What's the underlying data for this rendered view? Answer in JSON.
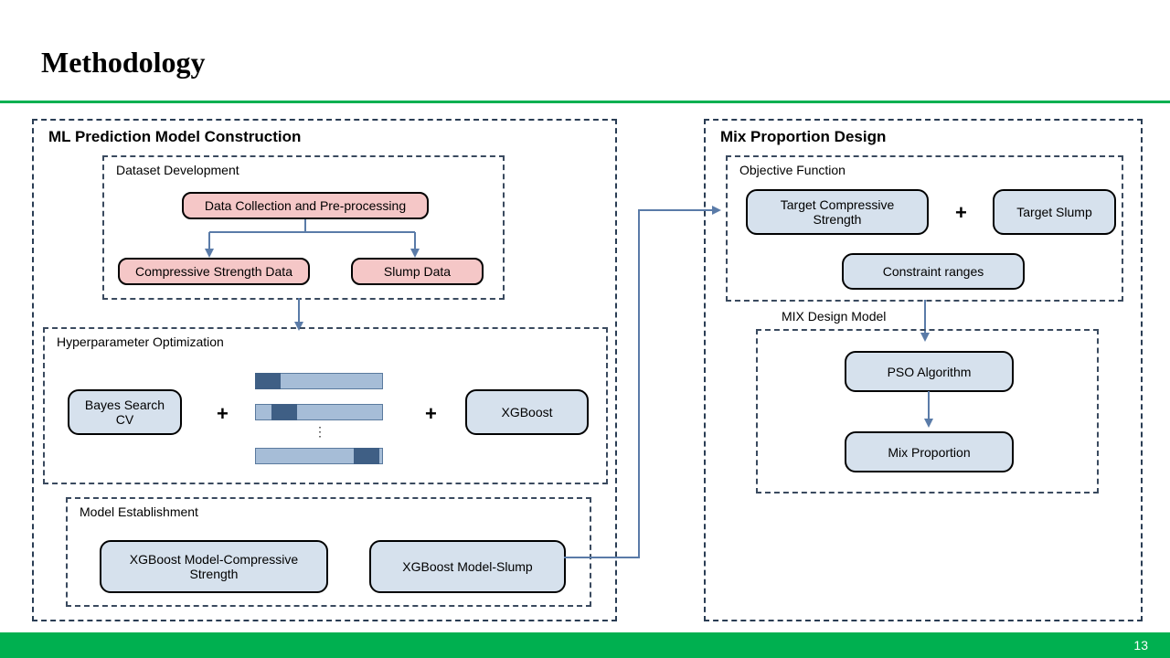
{
  "page": {
    "title": "Methodology",
    "pageNumber": "13"
  },
  "leftPanel": {
    "title": "ML Prediction Model Construction",
    "dataset": {
      "title": "Dataset Development",
      "dataCollection": "Data Collection and Pre-processing",
      "compressive": "Compressive Strength Data",
      "slump": "Slump Data"
    },
    "hyperparameter": {
      "title": "Hyperparameter Optimization",
      "bayes": "Bayes Search CV",
      "xgboost": "XGBoost",
      "plus": "+"
    },
    "modelEst": {
      "title": "Model Establishment",
      "model1": "XGBoost Model-Compressive Strength",
      "model2": "XGBoost Model-Slump"
    }
  },
  "rightPanel": {
    "title": "Mix Proportion Design",
    "objective": {
      "title": "Objective Function",
      "target1": "Target Compressive Strength",
      "target2": "Target Slump",
      "constraint": "Constraint ranges",
      "plus": "+"
    },
    "mixDesign": {
      "title": "MIX Design Model",
      "pso": "PSO Algorithm",
      "mixProp": "Mix Proportion"
    }
  }
}
